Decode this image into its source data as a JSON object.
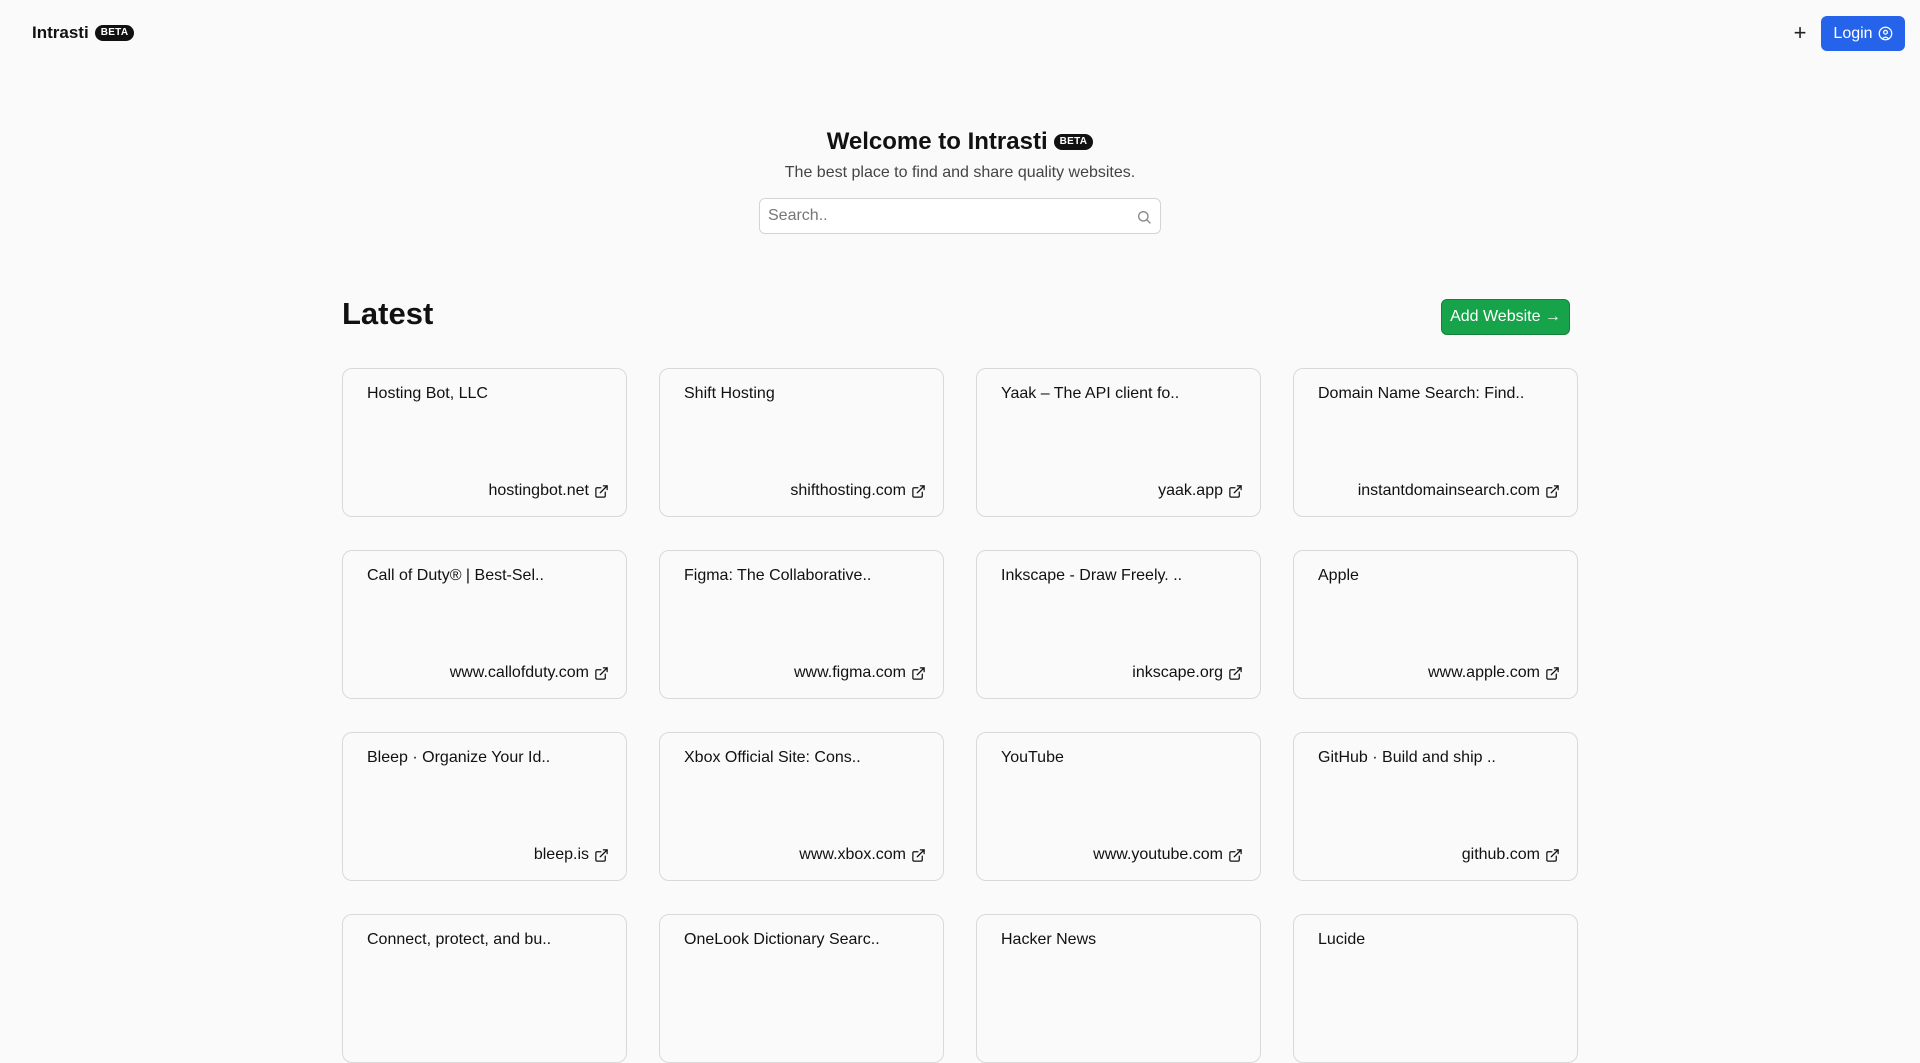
{
  "header": {
    "brand": "Intrasti",
    "badge": "BETA",
    "plus": "+",
    "login_label": "Login"
  },
  "hero": {
    "title": "Welcome to Intrasti",
    "badge": "BETA",
    "subtitle": "The best place to find and share quality websites.",
    "search_placeholder": "Search.."
  },
  "latest": {
    "heading": "Latest",
    "add_label": "Add Website →",
    "cards": [
      {
        "title": "Hosting Bot, LLC",
        "domain": "hostingbot.net"
      },
      {
        "title": "Shift Hosting",
        "domain": "shifthosting.com"
      },
      {
        "title": "Yaak – The API client fo..",
        "domain": "yaak.app"
      },
      {
        "title": "Domain Name Search: Find..",
        "domain": "instantdomainsearch.com"
      },
      {
        "title": "Call of Duty® | Best-Sel..",
        "domain": "www.callofduty.com"
      },
      {
        "title": "Figma: The Collaborative..",
        "domain": "www.figma.com"
      },
      {
        "title": "Inkscape - Draw Freely. ..",
        "domain": "inkscape.org"
      },
      {
        "title": "Apple",
        "domain": "www.apple.com"
      },
      {
        "title": "Bleep · Organize Your Id..",
        "domain": "bleep.is"
      },
      {
        "title": "Xbox Official Site: Cons..",
        "domain": "www.xbox.com"
      },
      {
        "title": "YouTube",
        "domain": "www.youtube.com"
      },
      {
        "title": "GitHub · Build and ship ..",
        "domain": "github.com"
      },
      {
        "title": "Connect, protect, and bu..",
        "domain": ""
      },
      {
        "title": "OneLook Dictionary Searc..",
        "domain": ""
      },
      {
        "title": "Hacker News",
        "domain": ""
      },
      {
        "title": "Lucide",
        "domain": ""
      }
    ]
  },
  "colors": {
    "login_bg": "#2563eb",
    "add_bg": "#16a34a",
    "page_bg": "#fafafa"
  }
}
